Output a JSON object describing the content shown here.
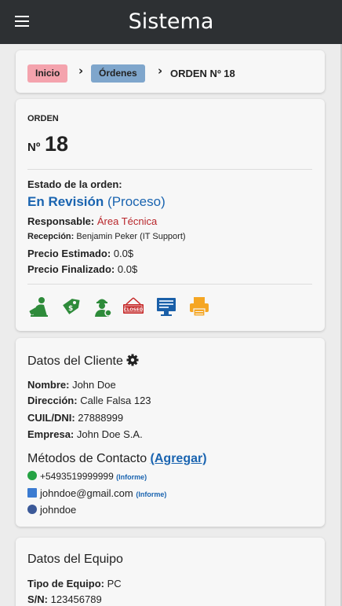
{
  "header": {
    "title": "Sistema"
  },
  "breadcrumb": {
    "home": "Inicio",
    "orders": "Órdenes",
    "current": "ORDEN Nº 18"
  },
  "order": {
    "label": "ORDEN",
    "number_prefix": "Nº",
    "number": "18",
    "status_label": "Estado de la orden:",
    "status": "En Revisión",
    "status_detail": "(Proceso)",
    "responsible_label": "Responsable:",
    "responsible": "Área Técnica",
    "reception_label": "Recepción:",
    "reception": "Benjamin Peker (IT Support)",
    "est_price_label": "Precio Estimado:",
    "est_price": "0.0$",
    "final_price_label": "Precio Finalizado:",
    "final_price": "0.0$",
    "actions": [
      "technician-icon",
      "price-tag-icon",
      "worker-icon",
      "closed-sign-icon",
      "invoice-monitor-icon",
      "printer-icon"
    ],
    "closed_text": "CLOSED"
  },
  "client": {
    "title": "Datos del Cliente",
    "name_label": "Nombre:",
    "name": "John Doe",
    "address_label": "Dirección:",
    "address": "Calle Falsa 123",
    "id_label": "CUIL/DNI:",
    "id": "27888999",
    "company_label": "Empresa:",
    "company": "John Doe S.A.",
    "contacts_title": "Métodos de Contacto",
    "add_link": "(Agregar)",
    "contacts": [
      {
        "icon": "whatsapp-icon",
        "value": "+5493519999999",
        "tag": "(Informe)"
      },
      {
        "icon": "email-icon",
        "value": "johndoe@gmail.com",
        "tag": "(Informe)"
      },
      {
        "icon": "facebook-icon",
        "value": "johndoe",
        "tag": ""
      }
    ]
  },
  "equipment": {
    "title": "Datos del Equipo",
    "type_label": "Tipo de Equipo:",
    "type": "PC",
    "serial_label": "S/N:",
    "serial": "123456789"
  },
  "colors": {
    "topbar": "#2d3033",
    "accent_blue": "#1a64b0",
    "responsible_red": "#b8262b",
    "green": "#2e8b3a",
    "orange": "#f5a623"
  }
}
